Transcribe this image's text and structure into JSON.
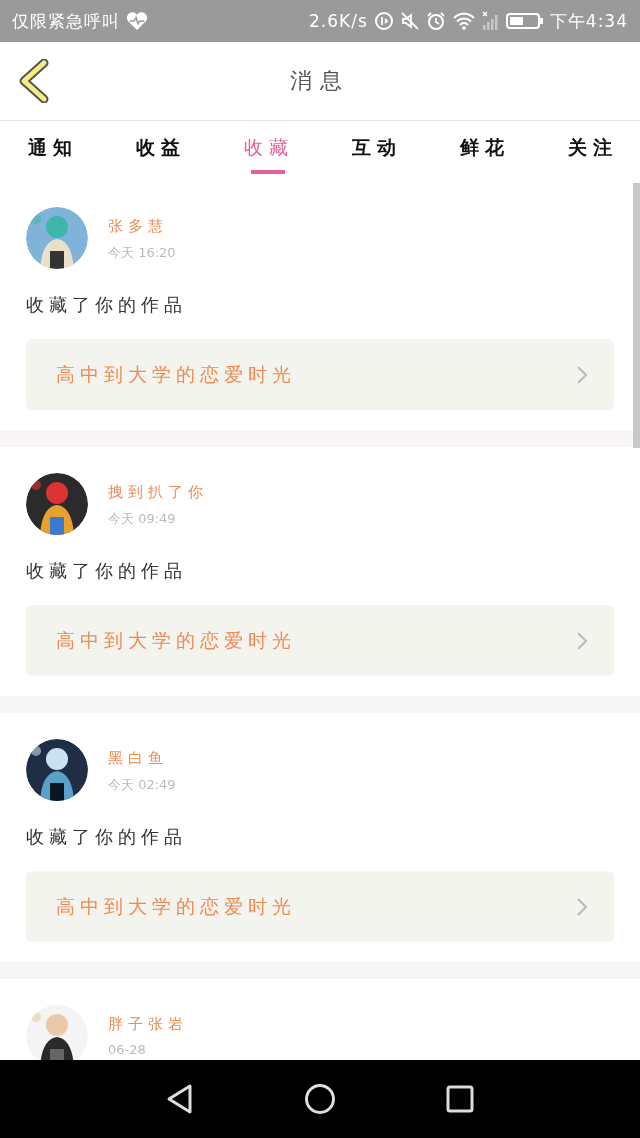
{
  "status_bar": {
    "carrier": "仅限紧急呼叫",
    "speed": "2.6K/s",
    "time": "下午4:34"
  },
  "header": {
    "title": "消息"
  },
  "tabs": [
    {
      "label": "通知",
      "selected": false
    },
    {
      "label": "收益",
      "selected": false
    },
    {
      "label": "收藏",
      "selected": true
    },
    {
      "label": "互动",
      "selected": false
    },
    {
      "label": "鲜花",
      "selected": false
    },
    {
      "label": "关注",
      "selected": false
    }
  ],
  "messages": [
    {
      "name": "张多慧",
      "time": "今天 16:20",
      "text": "收藏了你的作品",
      "work": "高中到大学的恋爱时光"
    },
    {
      "name": "拽到扒了你",
      "time": "今天 09:49",
      "text": "收藏了你的作品",
      "work": "高中到大学的恋爱时光"
    },
    {
      "name": "黑白鱼",
      "time": "今天 02:49",
      "text": "收藏了你的作品",
      "work": "高中到大学的恋爱时光"
    },
    {
      "name": "胖子张岩",
      "time": "06-28"
    }
  ]
}
